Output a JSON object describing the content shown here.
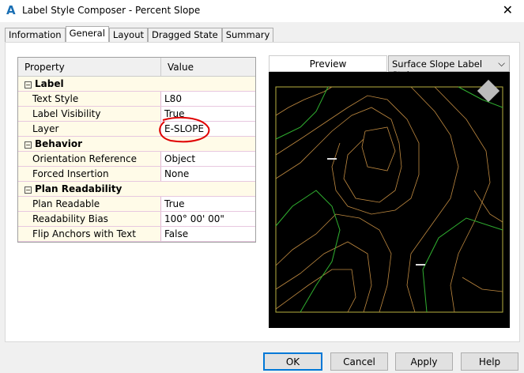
{
  "window": {
    "title": "Label Style Composer - Percent Slope",
    "app_icon": "A",
    "close": "✕"
  },
  "tabs": [
    {
      "label": "Information"
    },
    {
      "label": "General",
      "active": true
    },
    {
      "label": "Layout"
    },
    {
      "label": "Dragged State"
    },
    {
      "label": "Summary"
    }
  ],
  "grid": {
    "headers": [
      "Property",
      "Value"
    ],
    "rows": [
      {
        "type": "category",
        "label": "Label"
      },
      {
        "label": "Text Style",
        "value": "L80"
      },
      {
        "label": "Label Visibility",
        "value": "True"
      },
      {
        "label": "Layer",
        "value": "E-SLOPE"
      },
      {
        "type": "category",
        "label": "Behavior"
      },
      {
        "label": "Orientation Reference",
        "value": "Object"
      },
      {
        "label": "Forced Insertion",
        "value": "None"
      },
      {
        "type": "category",
        "label": "Plan Readability"
      },
      {
        "label": "Plan Readable",
        "value": "True"
      },
      {
        "label": "Readability Bias",
        "value": "100° 00' 00\""
      },
      {
        "label": "Flip Anchors with Text",
        "value": "False"
      }
    ]
  },
  "preview": {
    "tab": "Preview",
    "style_select": "Surface Slope Label Style",
    "annotation_color": "#e00000"
  },
  "buttons": {
    "ok": "OK",
    "cancel": "Cancel",
    "apply": "Apply",
    "help": "Help"
  }
}
